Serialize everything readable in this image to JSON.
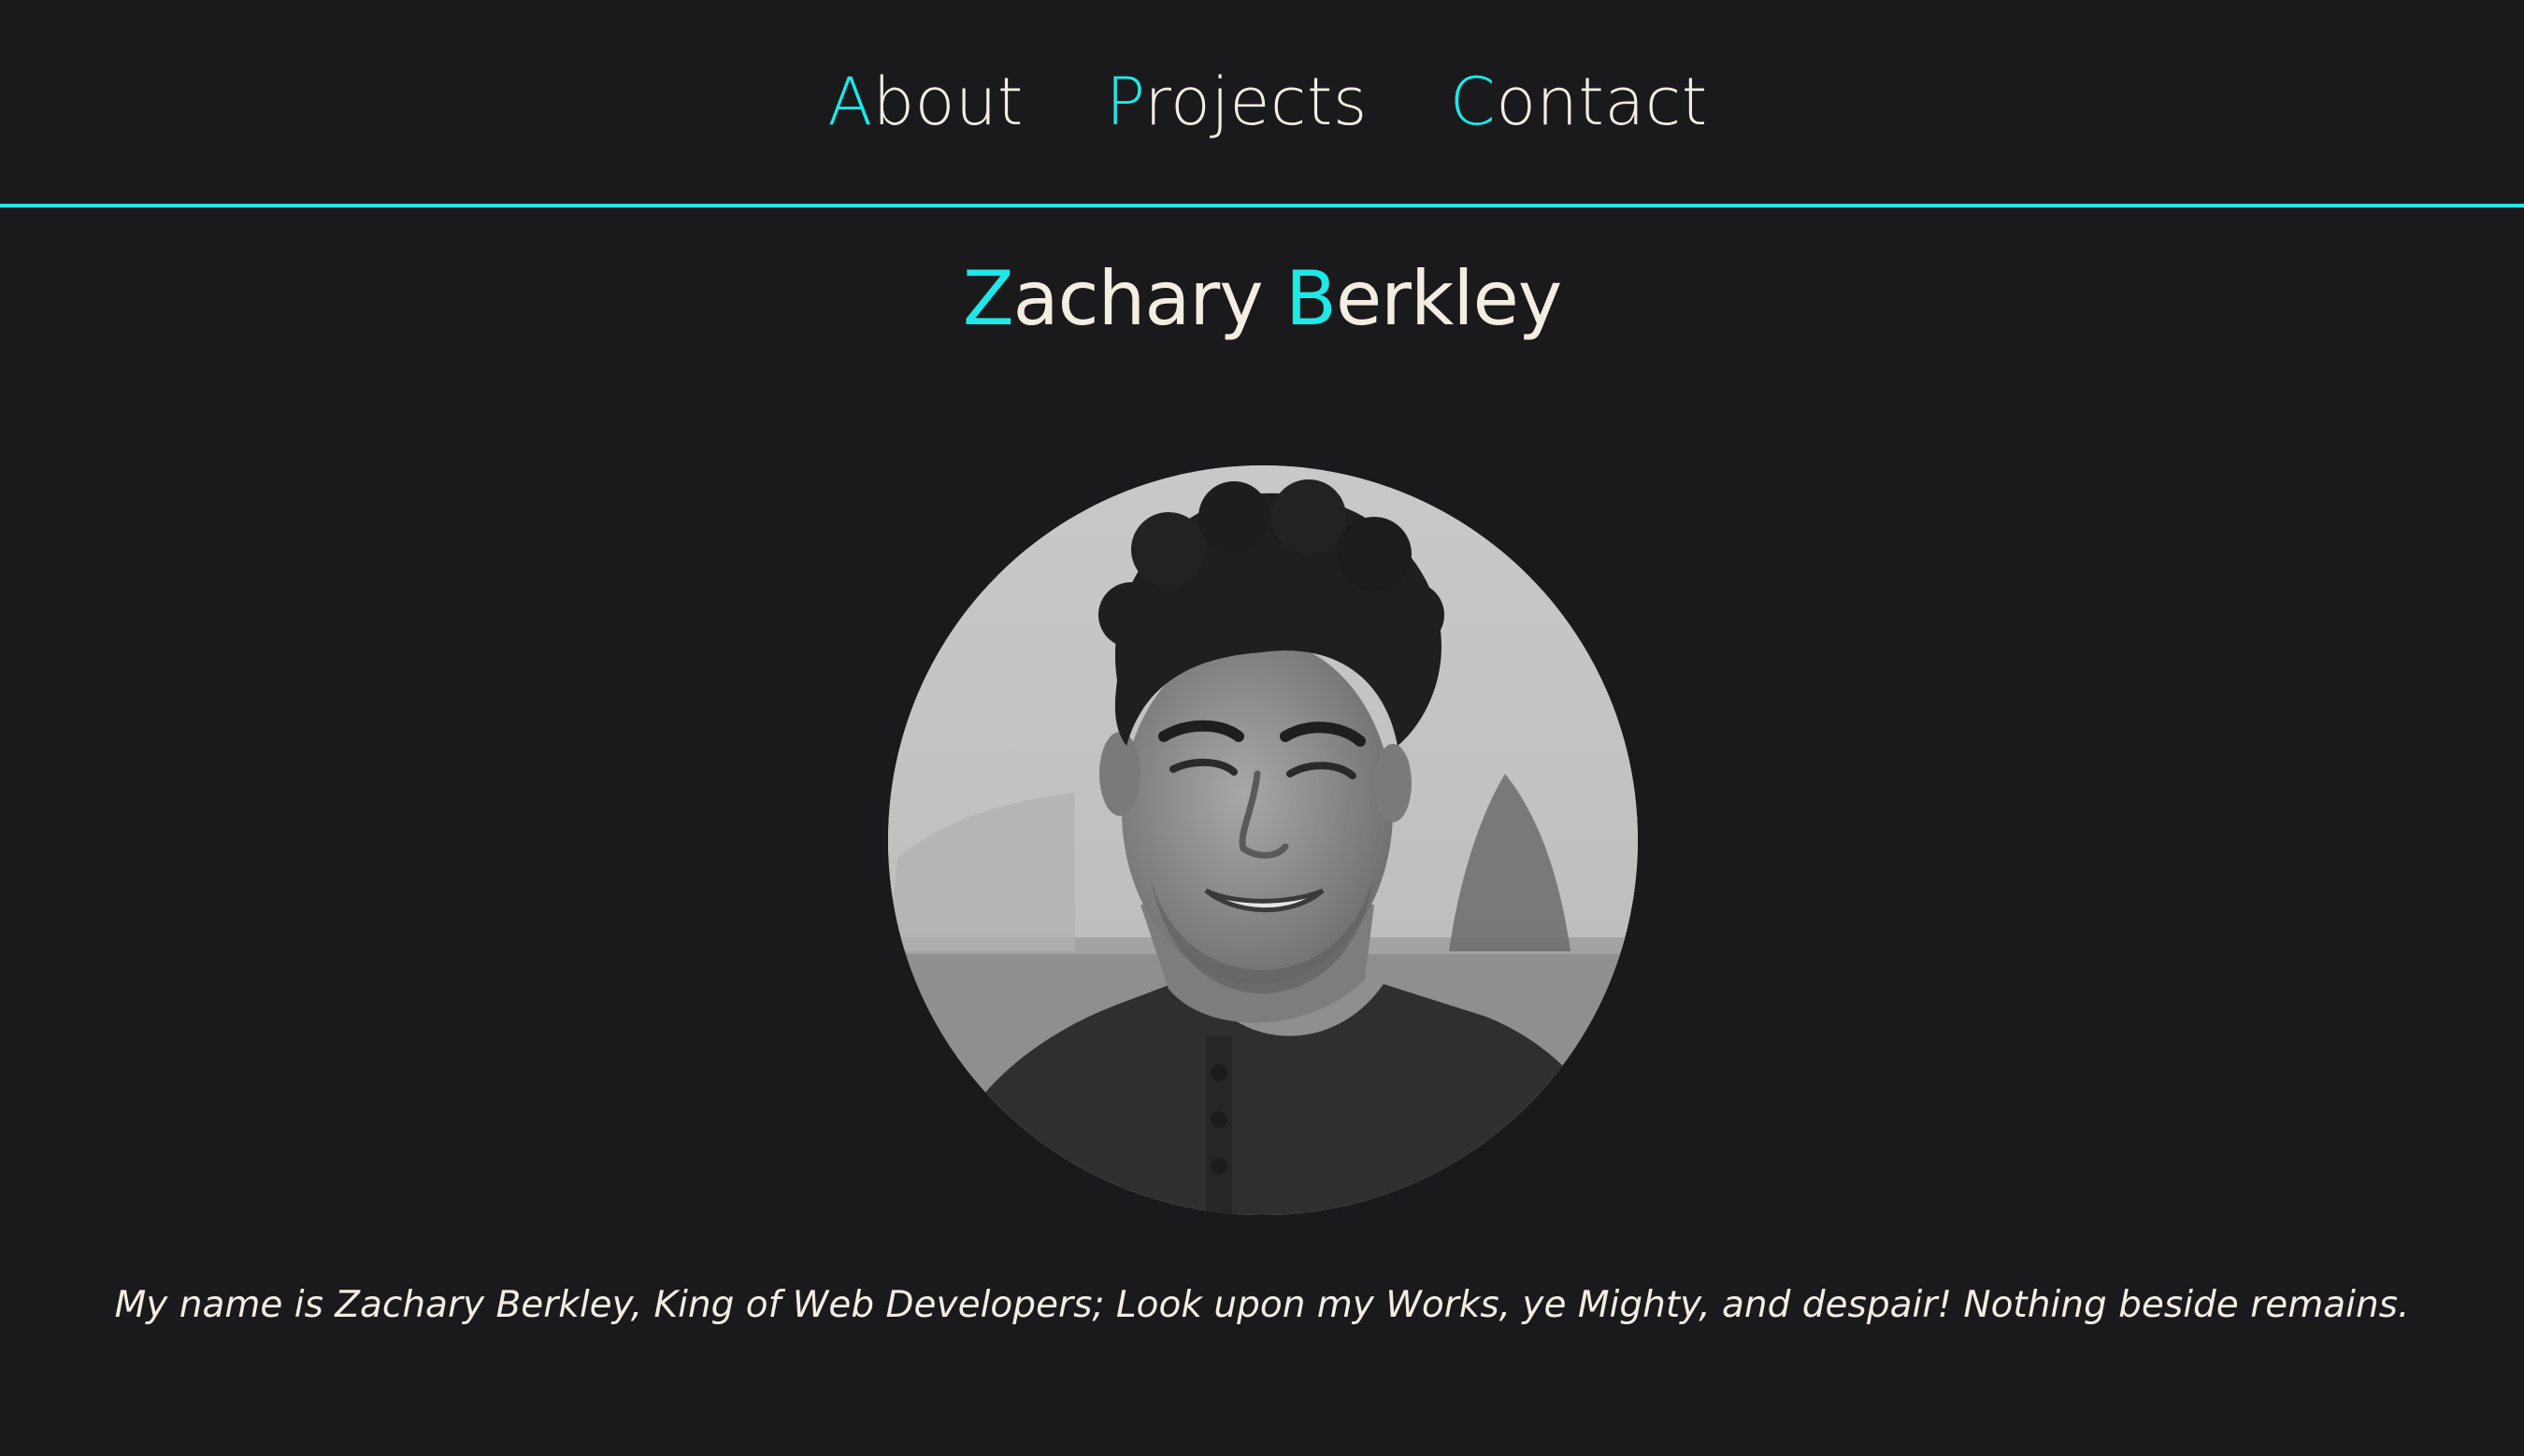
{
  "theme": {
    "background": "#1a1a1c",
    "accent": "#1ee8e8",
    "text": "#f3ede2"
  },
  "nav": {
    "items": [
      {
        "initial": "A",
        "rest": "bout"
      },
      {
        "initial": "P",
        "rest": "rojects"
      },
      {
        "initial": "C",
        "rest": "ontact"
      }
    ]
  },
  "header": {
    "first_initial": "Z",
    "first_rest": "achary",
    "last_initial": "B",
    "last_rest": "erkley"
  },
  "profile": {
    "photo_icon": "portrait-photo"
  },
  "bio": {
    "tagline": "My name is Zachary Berkley, King of Web Developers; Look upon my Works, ye Mighty, and despair! Nothing beside remains."
  }
}
